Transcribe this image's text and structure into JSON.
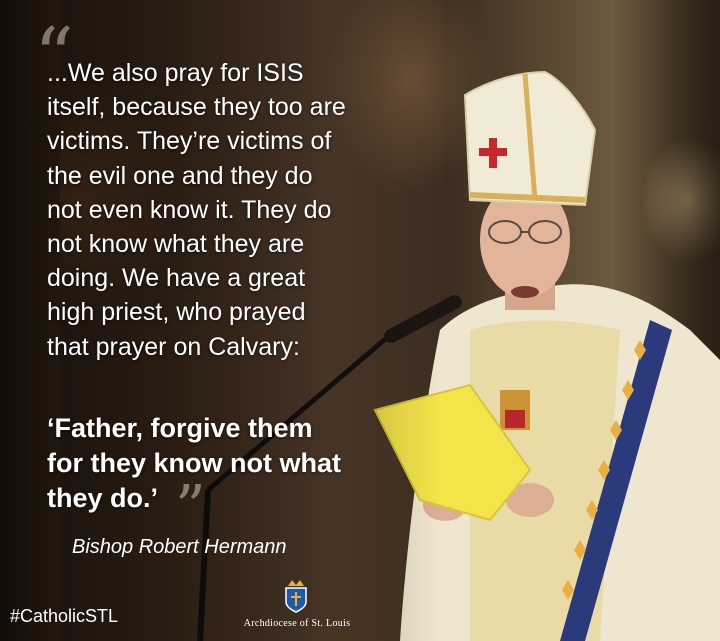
{
  "quote": {
    "text": "...We also pray for ISIS\nitself, because they too are\nvictims. They’re victims of\nthe evil one and they do\nnot even know it. They do\nnot know what they are\ndoing. We have a great\nhigh priest, who prayed\nthat prayer on Calvary:",
    "bold_text": "‘Father, forgive them\nfor they know not what\nthey do.’",
    "open_mark": "“",
    "close_mark": "”"
  },
  "attribution": "Bishop Robert Hermann",
  "hashtag": "#CatholicSTL",
  "logo": {
    "name": "Archdiocese of St. Louis",
    "icon": "crest-icon"
  },
  "colors": {
    "text": "#ffffff",
    "mitre": "#f1ead6",
    "vestment_gold": "#e7c96a",
    "paper": "#f3e44a",
    "cross_red": "#c8282c",
    "logo_blue": "#1e5aa8"
  }
}
